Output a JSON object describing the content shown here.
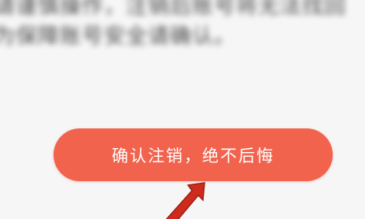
{
  "notice": {
    "line1": "请谨慎操作，注销后账号将无法找回",
    "line2": "为保障账号安全请确认。"
  },
  "confirm_button": {
    "label": "确认注销，绝不后悔"
  },
  "colors": {
    "button_bg": "#f2634e",
    "button_text": "#ffffff",
    "arrow": "#cc2b1d",
    "page_bg": "#f6f6f6"
  },
  "icons": {
    "pointer": "red-arrow-icon"
  }
}
